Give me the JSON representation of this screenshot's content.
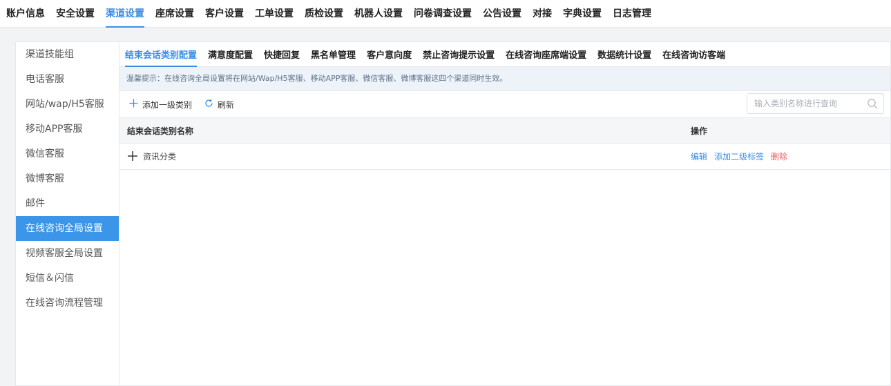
{
  "top_nav": {
    "items": [
      "账户信息",
      "安全设置",
      "渠道设置",
      "座席设置",
      "客户设置",
      "工单设置",
      "质检设置",
      "机器人设置",
      "问卷调查设置",
      "公告设置",
      "对接",
      "字典设置",
      "日志管理"
    ],
    "active_index": 2
  },
  "sidebar": {
    "items": [
      "渠道技能组",
      "电话客服",
      "网站/wap/H5客服",
      "移动APP客服",
      "微信客服",
      "微博客服",
      "邮件",
      "在线咨询全局设置",
      "视频客服全局设置",
      "短信＆闪信",
      "在线咨询流程管理"
    ],
    "active_index": 7
  },
  "sub_tabs": {
    "items": [
      "结束会话类别配置",
      "满意度配置",
      "快捷回复",
      "黑名单管理",
      "客户意向度",
      "禁止咨询提示设置",
      "在线咨询座席端设置",
      "数据统计设置",
      "在线咨询访客端"
    ],
    "active_index": 0
  },
  "notice": "温馨提示：在线咨询全局设置将在网站/Wap/H5客服、移动APP客服、微信客服、微博客服这四个渠道同时生效。",
  "toolbar": {
    "add_label": "添加一级类别",
    "refresh_label": "刷新",
    "search_placeholder": "输入类别名称进行查询",
    "search_value": ""
  },
  "table": {
    "columns": [
      "结束会话类别名称",
      "操作"
    ],
    "rows": [
      {
        "name": "资讯分类",
        "actions": [
          "编辑",
          "添加二级标签",
          "删除"
        ]
      }
    ]
  },
  "colors": {
    "accent": "#3a8ee6",
    "sidebar_active": "#3b95e8",
    "danger": "#f05a5a",
    "notice_bg": "#eef3f9"
  }
}
